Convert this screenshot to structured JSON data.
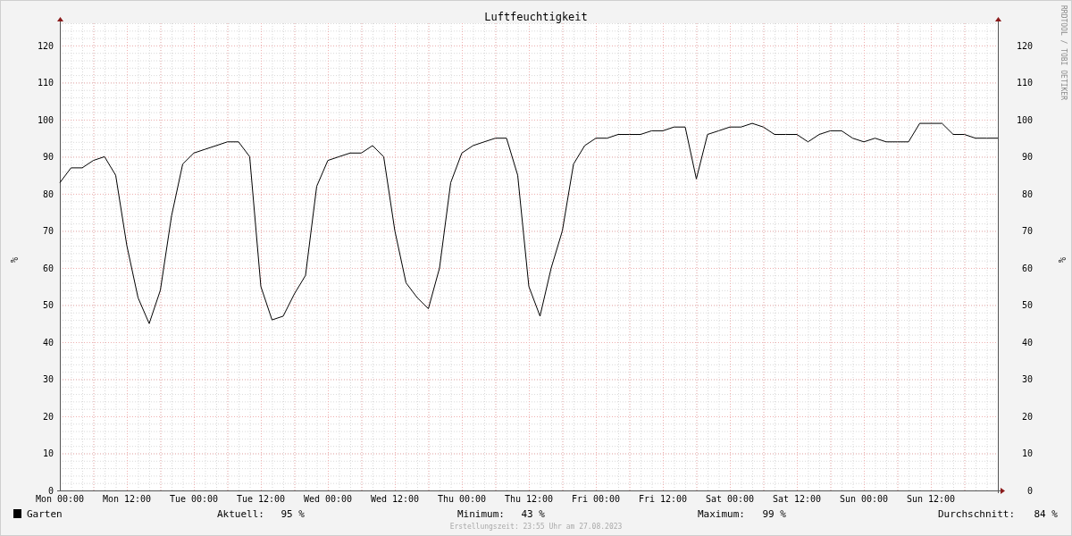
{
  "graph": {
    "credit": "RRDTOOL / TOBI OETIKER",
    "chart_data": {
      "type": "line",
      "title": "Luftfeuchtigkeit",
      "ylabel": "%",
      "grid": true,
      "ylim": [
        0,
        126
      ],
      "categories": [
        "Mon 00:00",
        null,
        null,
        null,
        null,
        null,
        "Mon 12:00",
        null,
        null,
        null,
        null,
        null,
        "Tue 00:00",
        null,
        null,
        null,
        null,
        null,
        "Tue 12:00",
        null,
        null,
        null,
        null,
        null,
        "Wed 00:00",
        null,
        null,
        null,
        null,
        null,
        "Wed 12:00",
        null,
        null,
        null,
        null,
        null,
        "Thu 00:00",
        null,
        null,
        null,
        null,
        null,
        "Thu 12:00",
        null,
        null,
        null,
        null,
        null,
        "Fri 00:00",
        null,
        null,
        null,
        null,
        null,
        "Fri 12:00",
        null,
        null,
        null,
        null,
        null,
        "Sat 00:00",
        null,
        null,
        null,
        null,
        null,
        "Sat 12:00",
        null,
        null,
        null,
        null,
        null,
        "Sun 00:00",
        null,
        null,
        null,
        null,
        null,
        "Sun 12:00",
        null,
        null,
        null,
        null,
        null,
        null
      ],
      "yticks": [
        0,
        10,
        20,
        30,
        40,
        50,
        60,
        70,
        80,
        90,
        100,
        110,
        120
      ],
      "series": [
        {
          "name": "Garten",
          "color": "#000000",
          "values": [
            83,
            87,
            87,
            89,
            90,
            85,
            66,
            52,
            45,
            54,
            74,
            88,
            91,
            92,
            93,
            94,
            94,
            90,
            55,
            46,
            47,
            53,
            58,
            82,
            89,
            90,
            91,
            91,
            93,
            90,
            70,
            56,
            52,
            49,
            60,
            83,
            91,
            93,
            94,
            95,
            95,
            85,
            55,
            47,
            60,
            70,
            88,
            93,
            95,
            95,
            96,
            96,
            96,
            97,
            97,
            98,
            98,
            84,
            96,
            97,
            98,
            98,
            99,
            98,
            96,
            96,
            96,
            94,
            96,
            97,
            97,
            95,
            94,
            95,
            94,
            94,
            94,
            99,
            99,
            99,
            96,
            96,
            95,
            95,
            95
          ]
        }
      ]
    },
    "right_axis": {
      "label": "%",
      "ticks": [
        "120",
        "110",
        "100",
        "90",
        "80",
        "70",
        "60",
        "50",
        "40",
        "30",
        "20",
        "10",
        "0"
      ]
    },
    "stats": [
      {
        "label": "Aktuell:",
        "value": "95 %"
      },
      {
        "label": "Minimum:",
        "value": "43 %"
      },
      {
        "label": "Maximum:",
        "value": "99 %"
      },
      {
        "label": "Durchschnitt:",
        "value": "84 %"
      }
    ],
    "footer": "Erstellungszeit: 23:55 Uhr am 27.08.2023"
  }
}
